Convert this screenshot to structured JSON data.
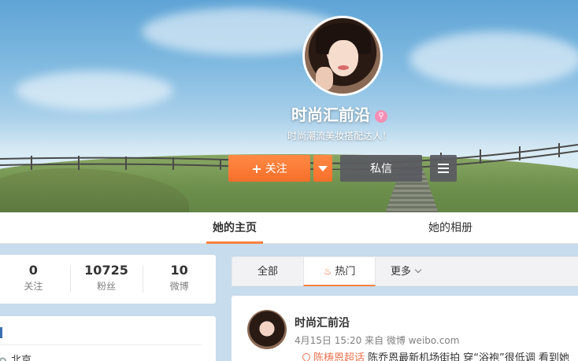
{
  "profile": {
    "nickname": "时尚汇前沿",
    "intro": "时尚潮流美妆搭配达人！",
    "follow_label": "关注",
    "message_label": "私信"
  },
  "tabs": {
    "home": "她的主页",
    "album": "她的相册"
  },
  "stats": [
    {
      "value": "0",
      "label": "关注"
    },
    {
      "value": "10725",
      "label": "粉丝"
    },
    {
      "value": "10",
      "label": "微博"
    }
  ],
  "info": {
    "location": "北京"
  },
  "feed_tabs": {
    "all": "全部",
    "hot": "热门",
    "more": "更多"
  },
  "post": {
    "author": "时尚汇前沿",
    "meta": "4月15日 15:20 来自 微博 weibo.com",
    "topic": "陈梼恩超话",
    "text": " 陈乔恩最新机场街拍 穿“浴袍”很低调 看到她"
  },
  "colors": {
    "accent": "#ff8140",
    "dark_button": "#5a5a62",
    "page_bg": "#c7dcec"
  }
}
